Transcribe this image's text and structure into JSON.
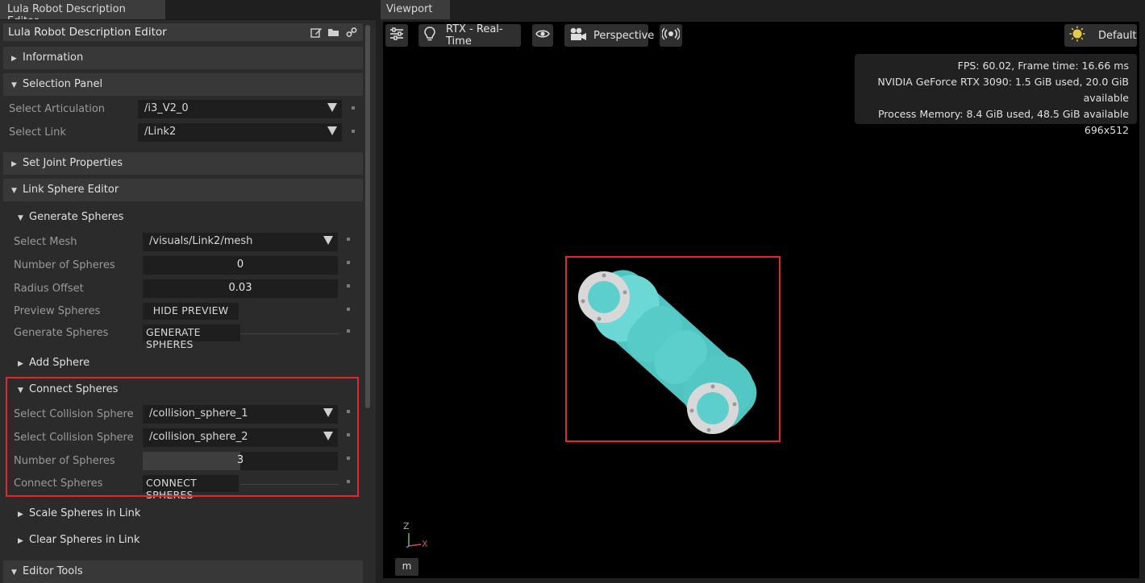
{
  "left_tab": {
    "title": "Lula Robot Description Editor"
  },
  "panel": {
    "title": "Lula Robot Description Editor",
    "icons": [
      "edit-icon",
      "folder-open-icon",
      "link-icon"
    ]
  },
  "sections": {
    "information": "Information",
    "selection_panel": "Selection Panel",
    "set_joint_properties": "Set Joint Properties",
    "link_sphere_editor": "Link Sphere Editor",
    "editor_tools": "Editor Tools"
  },
  "selection": {
    "articulation_label": "Select Articulation",
    "articulation_value": "/i3_V2_0",
    "link_label": "Select Link",
    "link_value": "/Link2"
  },
  "generate": {
    "title": "Generate Spheres",
    "mesh_label": "Select Mesh",
    "mesh_value": "/visuals/Link2/mesh",
    "num_label": "Number of Spheres",
    "num_value": "0",
    "radius_label": "Radius Offset",
    "radius_value": "0.03",
    "preview_label": "Preview Spheres",
    "preview_button": "HIDE PREVIEW",
    "generate_label": "Generate Spheres",
    "generate_button": "GENERATE SPHERES"
  },
  "add_sphere": {
    "title": "Add Sphere"
  },
  "connect": {
    "title": "Connect Spheres",
    "sphere1_label": "Select Collision Sphere",
    "sphere1_value": "/collision_sphere_1",
    "sphere2_label": "Select Collision Sphere",
    "sphere2_value": "/collision_sphere_2",
    "num_label": "Number of Spheres",
    "num_value": "3",
    "num_fill_fraction": 0.5,
    "connect_label": "Connect Spheres",
    "connect_button": "CONNECT SPHERES"
  },
  "scale": {
    "title": "Scale Spheres in Link"
  },
  "clear": {
    "title": "Clear Spheres in Link"
  },
  "viewport": {
    "tab": "Viewport",
    "renderer": "RTX - Real-Time",
    "camera": "Perspective",
    "lighting": "Default",
    "stats": {
      "fps": "FPS: 60.02, Frame time: 16.66 ms",
      "gpu": "NVIDIA GeForce RTX 3090: 1.5 GiB used, 20.0 GiB available",
      "memory": "Process Memory: 8.4 GiB used, 48.5 GiB available",
      "resolution": "696x512"
    },
    "axis_z": "Z",
    "axis_x": "X",
    "unit": "m"
  },
  "colors": {
    "highlight": "#e0282e",
    "robot_body": "#5ccfcc",
    "robot_flange": "#d9d9d9"
  }
}
